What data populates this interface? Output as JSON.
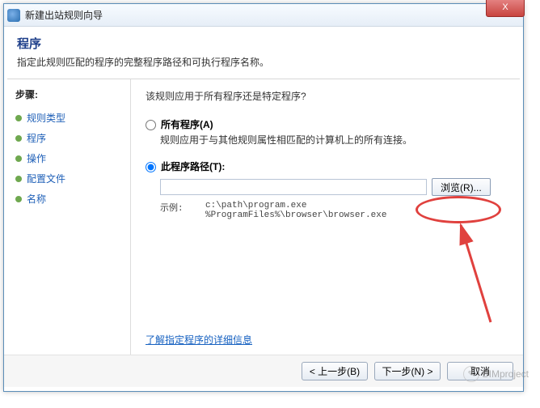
{
  "title": "新建出站规则向导",
  "header": {
    "title": "程序",
    "subtitle": "指定此规则匹配的程序的完整程序路径和可执行程序名称。"
  },
  "sidebar": {
    "title": "步骤:",
    "items": [
      {
        "label": "规则类型"
      },
      {
        "label": "程序"
      },
      {
        "label": "操作"
      },
      {
        "label": "配置文件"
      },
      {
        "label": "名称"
      }
    ]
  },
  "content": {
    "question": "该规则应用于所有程序还是特定程序?",
    "opt_all": {
      "label": "所有程序(A)",
      "desc": "规则应用于与其他规则属性相匹配的计算机上的所有连接。"
    },
    "opt_path": {
      "label": "此程序路径(T):",
      "value": "",
      "browse": "浏览(R)..."
    },
    "example_label": "示例:",
    "example_text": "c:\\path\\program.exe\n%ProgramFiles%\\browser\\browser.exe",
    "learn_more": "了解指定程序的详细信息"
  },
  "footer": {
    "back": "< 上一步(B)",
    "next": "下一步(N) >",
    "cancel": "取消"
  },
  "close": "X",
  "watermark": "BIMproject"
}
